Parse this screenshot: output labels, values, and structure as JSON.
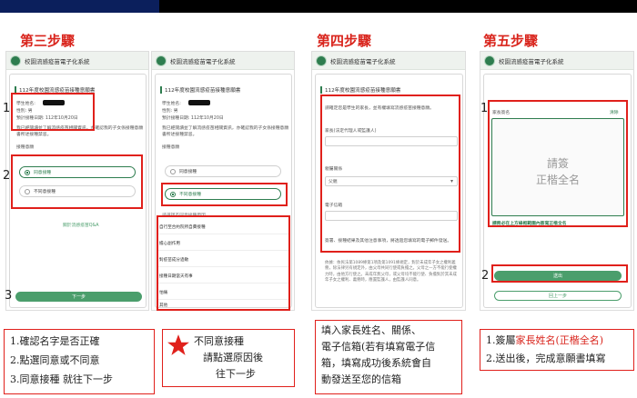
{
  "steps": {
    "step3": "第三步驟",
    "step4": "第四步驟",
    "step5": "第五步驟"
  },
  "app": {
    "title": "校園流感疫苗電子化系統"
  },
  "s3a": {
    "card_title": "112年度校園流感疫苗接種意願書",
    "student_name_label": "學生姓名:",
    "gender": "性別: 男",
    "date": "預計接種日期: 112年10月20日",
    "desc": "我已經閱讀並了解流感疫苗相關資訊，亦確認我的子女係接種意願書所述接種禁忌。",
    "section": "接種意願",
    "opt_agree": "同意接種",
    "opt_disagree": "不同意接種",
    "link": "關於流感疫苗Q&A",
    "next": "下一步"
  },
  "s3b": {
    "card_title": "112年度校園流感疫苗接種意願書",
    "student_name_label": "學生姓名:",
    "gender": "性別: 男",
    "date": "預計接種日期: 112年10月20日",
    "desc": "我已經閱讀並了解流感疫苗相關資訊，亦確認我的子女係接種意願書所述接種禁忌。",
    "section": "接種意願",
    "opt_agree": "同意接種",
    "opt_disagree": "不同意接種",
    "reason_header": "請選擇不同意接種原因",
    "reasons": [
      "自行至合約院所自費接種",
      "擔心副作用",
      "對疫苗成分過敏",
      "接種日期當天有事",
      "怕痛",
      "其他"
    ]
  },
  "s4": {
    "card_title": "112年度校園流感疫苗接種意願書",
    "desc": "請確定您是學生的家長，並有權填寫流感疫苗接種意願。",
    "parent_name_label": "家長(法定代理人或監護人)",
    "relation_label": "親屬關係",
    "relation_value": "父親",
    "email_label": "電子信箱",
    "notice": "簽署、接種結果及其他注意事項，將透過您填寫的電子郵件發送。",
    "legal": "依據：依民法第1089條第1項及第1091條規定，對於未成年子女之權利義務，除法律另有規定外，由父母共同行使或負擔之。父母之一方不能行使權力時，由他方行使之。未成年無父母，或父母均不能行使、負擔對於其未成年子女之權利、義務時，應置監護人，由監護人同意。"
  },
  "s5": {
    "sig_label": "家長簽名",
    "clear": "清除",
    "placeholder_line1": "請簽",
    "placeholder_line2": "正楷全名",
    "warning": "請務必在上方綠框範圍內簽寫正楷全名",
    "submit": "送出",
    "back": "回上一步"
  },
  "numbers": {
    "n1": "1",
    "n2": "2",
    "n3": "3"
  },
  "notes": {
    "step3": [
      "1.確認名字是否正確",
      "2.點選同意或不同意",
      "3.同意接種 就往下一步"
    ],
    "step3b": [
      "不同意接種",
      "請點選原因後",
      "往下一步"
    ],
    "step4": [
      "填入家長姓名、關係、",
      "電子信箱(若有填寫電子信",
      "箱，填寫成功後系統會自",
      "動發送至您的信箱"
    ],
    "step5_line1_prefix": "1.簽屬",
    "step5_line1_highlight": "家長姓名(正楷全名)",
    "step5_line2": "2.送出後，完成意願書填寫"
  },
  "colors": {
    "accent": "#2e7d4f",
    "highlight": "#e0201b",
    "title": "#d9241c"
  }
}
